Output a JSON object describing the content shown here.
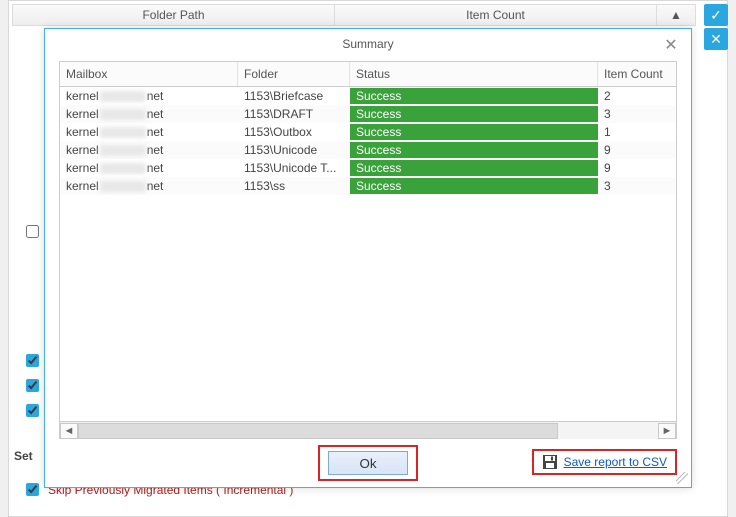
{
  "bg": {
    "col_folder_path": "Folder Path",
    "col_item_count": "Item Count",
    "settings_label": "Set",
    "skip_label": "Skip Previously Migrated Items ( Incremental )"
  },
  "dialog": {
    "title": "Summary",
    "columns": {
      "mailbox": "Mailbox",
      "folder": "Folder",
      "status": "Status",
      "item_count": "Item Count"
    },
    "rows": [
      {
        "mail_pre": "kernel",
        "mail_post": "net",
        "folder": "1153\\Briefcase",
        "status": "Success",
        "count": "2"
      },
      {
        "mail_pre": "kernel",
        "mail_post": "net",
        "folder": "1153\\DRAFT",
        "status": "Success",
        "count": "3"
      },
      {
        "mail_pre": "kernel",
        "mail_post": "net",
        "folder": "1153\\Outbox",
        "status": "Success",
        "count": "1"
      },
      {
        "mail_pre": "kernel",
        "mail_post": "net",
        "folder": "1153\\Unicode",
        "status": "Success",
        "count": "9"
      },
      {
        "mail_pre": "kernel",
        "mail_post": "net",
        "folder": "1153\\Unicode T...",
        "status": "Success",
        "count": "9"
      },
      {
        "mail_pre": "kernel",
        "mail_post": "net",
        "folder": "1153\\ss",
        "status": "Success",
        "count": "3"
      }
    ],
    "ok_label": "Ok",
    "save_label": "Save report to CSV"
  }
}
